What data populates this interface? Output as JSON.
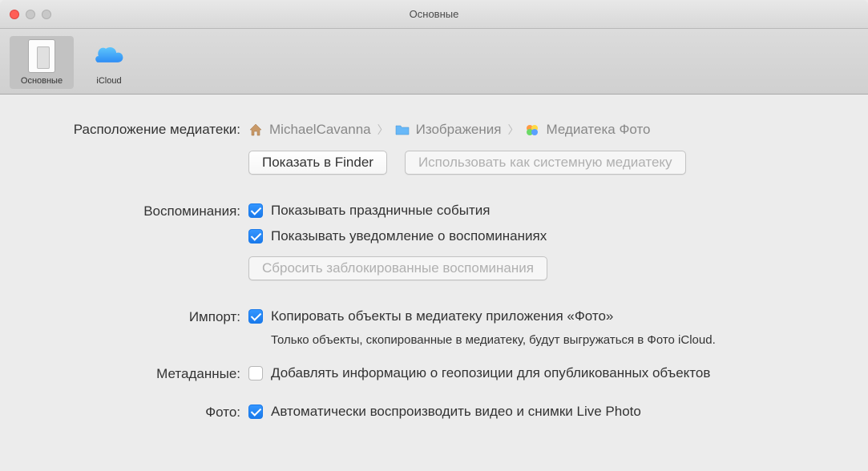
{
  "window": {
    "title": "Основные"
  },
  "toolbar": {
    "general": "Основные",
    "icloud": "iCloud"
  },
  "location": {
    "label": "Расположение медиатеки:",
    "breadcrumb": {
      "home": "MichaelCavanna",
      "folder": "Изображения",
      "library": "Медиатека Фото"
    },
    "show_in_finder": "Показать в Finder",
    "use_as_system": "Использовать как системную медиатеку"
  },
  "memories": {
    "label": "Воспоминания:",
    "show_holidays": "Показывать праздничные события",
    "show_notifications": "Показывать уведомление о воспоминаниях",
    "reset_blocked": "Сбросить заблокированные воспоминания"
  },
  "import": {
    "label": "Импорт:",
    "copy_items": "Копировать объекты в медиатеку приложения «Фото»",
    "help": "Только объекты, скопированные в медиатеку, будут выгружаться в Фото iCloud."
  },
  "metadata": {
    "label": "Метаданные:",
    "include_location": "Добавлять информацию о геопозиции для опубликованных объектов"
  },
  "photos": {
    "label": "Фото:",
    "autoplay": "Автоматически воспроизводить видео и снимки Live Photo"
  }
}
